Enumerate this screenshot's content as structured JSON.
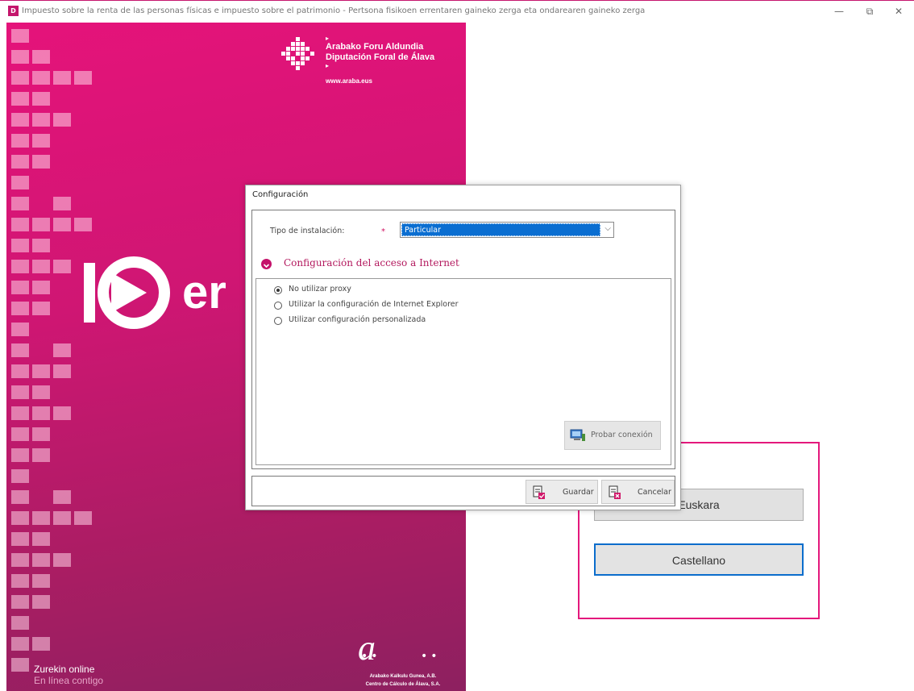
{
  "window": {
    "title": "Impuesto sobre la renta de las personas físicas e impuesto sobre el patrimonio - Pertsona fisikoen errentaren gaineko zerga eta ondarearen gaineko zerga",
    "app_icon_glyph": "D",
    "minimize_glyph": "—",
    "restore_glyph": "⧉",
    "close_glyph": "✕"
  },
  "branding": {
    "org_line1": "Arabako Foru Aldundia",
    "org_line2": "Diputación Foral de Álava",
    "arrow": "▸",
    "url": "www.araba.eus",
    "big_text": "er",
    "footer_line1": "Zurekin online",
    "footer_line2": "En línea contigo",
    "cc_letter": "a",
    "cc_dots": "••",
    "cc_line1": "Arabako Kalkulu Gunea, A.B.",
    "cc_line2": "Centro de Cálculo de Álava, S.A.",
    "accent_color": "#e4187c"
  },
  "language": {
    "euskara_label": "Euskara",
    "castellano_label": "Castellano"
  },
  "dialog": {
    "title": "Configuración",
    "tipo_label": "Tipo de instalación:",
    "required_mark": "*",
    "tipo_value": "Particular",
    "chevron": "⌵",
    "section_title": "Configuración del acceso a Internet",
    "options": [
      {
        "label": "No utilizar proxy",
        "selected": true
      },
      {
        "label": "Utilizar la configuración de Internet Explorer",
        "selected": false
      },
      {
        "label": "Utilizar configuración personalizada",
        "selected": false
      }
    ],
    "probar_label": "Probar conexión",
    "guardar_label": "Guardar",
    "cancelar_label": "Cancelar"
  }
}
